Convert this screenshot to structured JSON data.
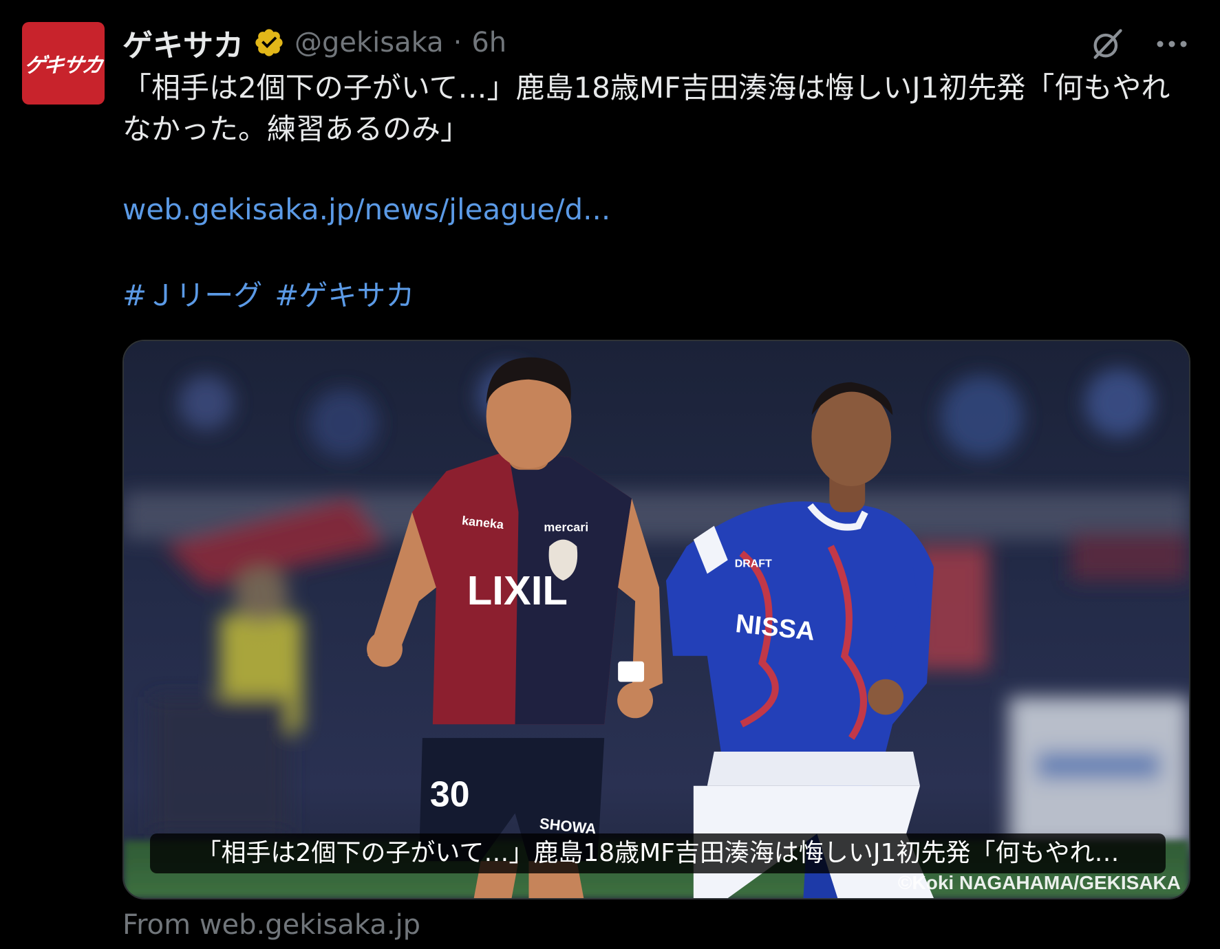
{
  "tweet": {
    "avatar_text": "ゲキサカ",
    "display_name": "ゲキサカ",
    "handle": "@gekisaka",
    "separator": "·",
    "time": "6h",
    "text": "「相手は2個下の子がいて…」鹿島18歳MF吉田湊海は悔しいJ1初先発「何もやれなかった。練習あるのみ」",
    "link": "web.gekisaka.jp/news/jleague/d...",
    "hashtags": [
      "#Ｊリーグ",
      "#ゲキサカ"
    ],
    "card": {
      "caption": "「相手は2個下の子がいて…」鹿島18歳MF吉田湊海は悔しいJ1初先発「何もやれ…",
      "credit": "©Koki NAGAHAMA/GEKISAKA",
      "jersey_left_sponsor": "LIXIL",
      "jersey_left_number": "30",
      "jersey_left_chest": "mercari",
      "jersey_left_sleeve": "kaneka",
      "jersey_left_shorts": "SHOWA",
      "jersey_right_sponsor": "NISSA",
      "jersey_right_chest": "DRAFT"
    },
    "source": "From web.gekisaka.jp"
  },
  "icons": {
    "verified": "verified-badge-icon",
    "grok": "grok-icon",
    "more": "more-options-icon"
  },
  "colors": {
    "background": "#000000",
    "text": "#e7e9ea",
    "muted": "#71767b",
    "link": "#5b9ae6",
    "avatar_bg": "#c8232c",
    "verified_gold": "#e2b719"
  }
}
